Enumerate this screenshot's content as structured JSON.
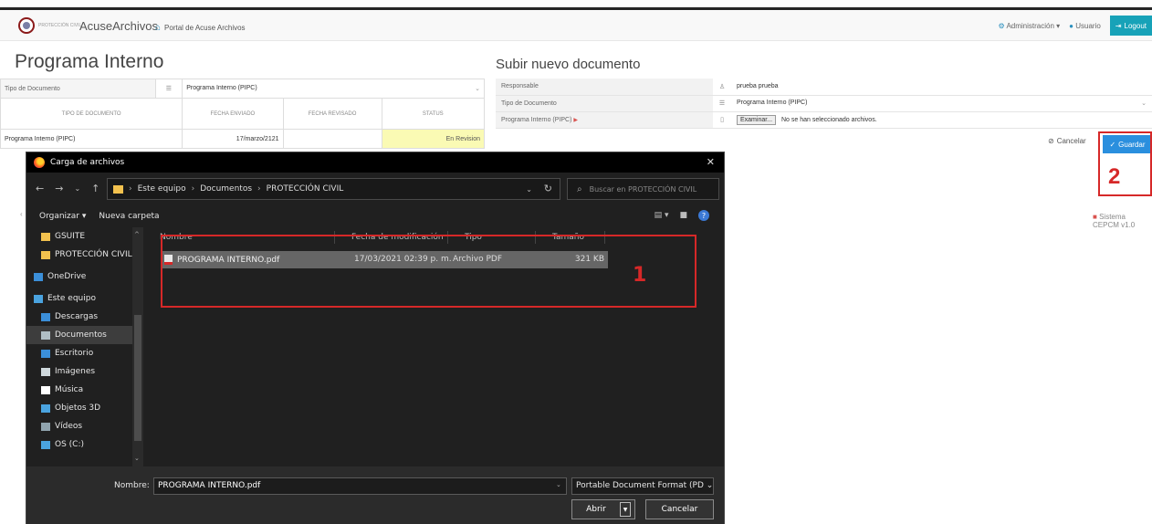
{
  "app": {
    "logo_text": "PROTECCIÓN CIVIL",
    "brand": "AcuseArchivos",
    "portal_link": "Portal de Acuse Archivos",
    "nav_admin": "Administración",
    "nav_user": "Usuario",
    "nav_logout": "Logout",
    "footer": "Sistema CEPCM v1.0"
  },
  "left_panel": {
    "title": "Programa Interno",
    "filter_label": "Tipo de Documento",
    "filter_value": "Programa Interno (PIPC)",
    "columns": [
      "TIPO DE DOCUMENTO",
      "FECHA ENVIADO",
      "FECHA REVISADO",
      "STATUS"
    ],
    "rows": [
      {
        "tipo": "Programa Interno (PIPC)",
        "enviado": "17/marzo/2121",
        "revisado": "",
        "status": "En Revision"
      }
    ]
  },
  "right_panel": {
    "title": "Subir nuevo documento",
    "responsable_label": "Responsable",
    "responsable_value": "prueba prueba",
    "tipo_label": "Tipo de Documento",
    "tipo_value": "Programa Interno (PIPC)",
    "archivo_label": "Programa Interno (PIPC)",
    "browse_label": "Examinar...",
    "no_file_text": "No se han seleccionado archivos.",
    "cancel_label": "Cancelar",
    "save_label": "Guardar"
  },
  "annotations": {
    "step1": "1",
    "step2": "2"
  },
  "dialog": {
    "title": "Carga de archivos",
    "breadcrumb": [
      "Este equipo",
      "Documentos",
      "PROTECCIÓN CIVIL"
    ],
    "search_placeholder": "Buscar en PROTECCIÓN CIVIL",
    "organize_label": "Organizar",
    "new_folder_label": "Nueva carpeta",
    "nav_items": [
      {
        "label": "GSUITE",
        "icon": "folder-icon",
        "color": "#f2c14e"
      },
      {
        "label": "PROTECCIÓN CIVIL",
        "icon": "folder-icon",
        "color": "#f2c14e"
      },
      {
        "label": "OneDrive",
        "icon": "cloud-icon",
        "color": "#3b8fd9"
      },
      {
        "label": "Este equipo",
        "icon": "computer-icon",
        "color": "#4aa3df"
      },
      {
        "label": "Descargas",
        "icon": "download-icon",
        "color": "#3b8fd9"
      },
      {
        "label": "Documentos",
        "icon": "document-icon",
        "color": "#b0bec5"
      },
      {
        "label": "Escritorio",
        "icon": "desktop-icon",
        "color": "#3b8fd9"
      },
      {
        "label": "Imágenes",
        "icon": "image-icon",
        "color": "#cfd8dc"
      },
      {
        "label": "Música",
        "icon": "music-icon",
        "color": "#ffffff"
      },
      {
        "label": "Objetos 3D",
        "icon": "cube-icon",
        "color": "#4aa3df"
      },
      {
        "label": "Vídeos",
        "icon": "video-icon",
        "color": "#90a4ae"
      },
      {
        "label": "OS (C:)",
        "icon": "drive-icon",
        "color": "#4aa3df"
      }
    ],
    "columns": [
      "Nombre",
      "Fecha de modificación",
      "Tipo",
      "Tamaño"
    ],
    "file": {
      "name": "PROGRAMA INTERNO.pdf",
      "date": "17/03/2021 02:39 p. m.",
      "type": "Archivo PDF",
      "size": "321 KB"
    },
    "filename_label": "Nombre:",
    "filename_value": "PROGRAMA INTERNO.pdf",
    "filter_value": "Portable Document Format (PD",
    "open_label": "Abrir",
    "cancel_label": "Cancelar"
  }
}
